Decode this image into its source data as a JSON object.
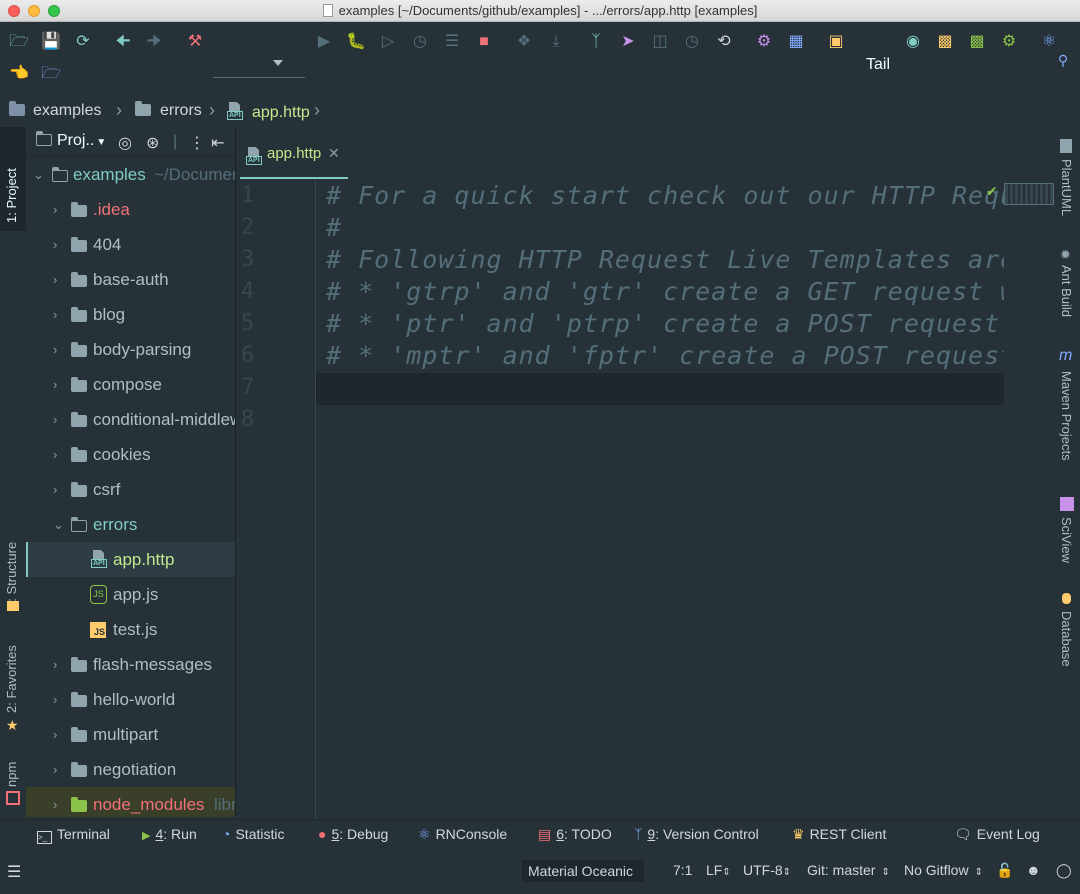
{
  "window": {
    "title": "examples [~/Documents/github/examples] - .../errors/app.http [examples]"
  },
  "toolbar": {
    "tail_label": "Tail"
  },
  "breadcrumb": {
    "items": [
      "examples",
      "errors",
      "app.http"
    ]
  },
  "left_strip": {
    "project": "1: Project",
    "structure": "7: Structure",
    "favorites": "2: Favorites",
    "npm": "npm"
  },
  "project_panel": {
    "title": "Proj..",
    "root": {
      "name": "examples",
      "path": "~/Documents/github/examples"
    },
    "items": [
      {
        "name": ".idea",
        "color": "#f07178"
      },
      {
        "name": "404"
      },
      {
        "name": "base-auth"
      },
      {
        "name": "blog"
      },
      {
        "name": "body-parsing"
      },
      {
        "name": "compose"
      },
      {
        "name": "conditional-middleware"
      },
      {
        "name": "cookies"
      },
      {
        "name": "csrf"
      },
      {
        "name": "errors"
      },
      {
        "name": "app.http"
      },
      {
        "name": "app.js"
      },
      {
        "name": "test.js"
      },
      {
        "name": "flash-messages"
      },
      {
        "name": "hello-world"
      },
      {
        "name": "multipart"
      },
      {
        "name": "negotiation"
      },
      {
        "name": "node_modules",
        "suffix": "library root"
      }
    ]
  },
  "editor": {
    "tab": "app.http",
    "line_numbers": [
      "1",
      "2",
      "3",
      "4",
      "5",
      "6",
      "7",
      "8"
    ],
    "lines": [
      "# For a quick start check out our HTTP Requests",
      "#",
      "# Following HTTP Request Live Templates are available:",
      "# * 'gtrp' and 'gtr' create a GET request with",
      "# * 'ptr' and 'ptrp' create a POST request with",
      "# * 'mptr' and 'fptr' create a POST request to",
      "",
      ""
    ]
  },
  "right_strip": {
    "plantuml": "PlantUML",
    "ant": "Ant Build",
    "maven": "Maven Projects",
    "sciview": "SciView",
    "database": "Database"
  },
  "bottom_tabs": {
    "terminal": "Terminal",
    "run_key": "4",
    "run": ": Run",
    "statistic": "Statistic",
    "debug_key": "5",
    "debug": ": Debug",
    "rnconsole": "RNConsole",
    "todo_key": "6",
    "todo": ": TODO",
    "vc_key": "9",
    "vc": ": Version Control",
    "rest": "REST Client",
    "eventlog": "Event Log"
  },
  "status": {
    "theme": "Material Oceanic",
    "position": "7:1",
    "line_sep": "LF",
    "encoding": "UTF-8",
    "git": "Git: master",
    "gitflow": "No Gitflow"
  },
  "colors": {
    "accent": "#80cbc4",
    "folder": "#90a4ae",
    "string": "#c3e88d",
    "error": "#f07178",
    "bg": "#263238"
  }
}
